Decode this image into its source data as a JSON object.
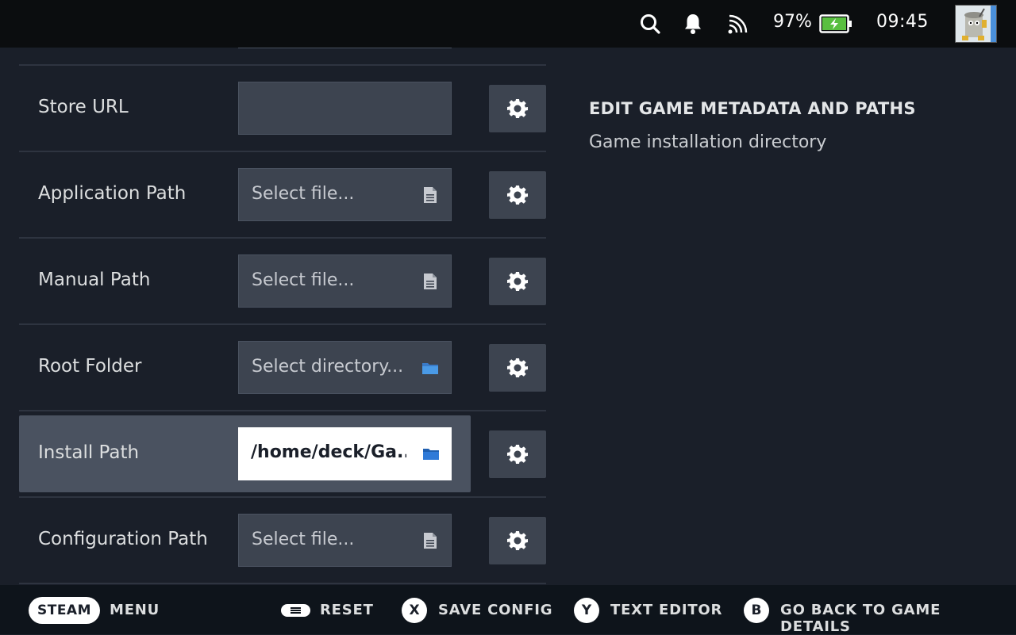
{
  "status_bar": {
    "battery_percent": "97%",
    "clock": "09:45",
    "icons": [
      "search-icon",
      "bell-icon",
      "wifi-icon",
      "battery-icon",
      "avatar"
    ]
  },
  "rows": [
    {
      "label": "Store URL",
      "value": "",
      "icon": "none"
    },
    {
      "label": "Application Path",
      "value": "Select file...",
      "icon": "file-icon"
    },
    {
      "label": "Manual Path",
      "value": "Select file...",
      "icon": "file-icon"
    },
    {
      "label": "Root Folder",
      "value": "Select directory...",
      "icon": "folder-icon"
    },
    {
      "label": "Install Path",
      "value": "/home/deck/Ga...",
      "icon": "folder-icon"
    },
    {
      "label": "Configuration Path",
      "value": "Select file...",
      "icon": "file-icon"
    }
  ],
  "panel": {
    "title": "EDIT GAME METADATA AND PATHS",
    "description": "Game installation directory"
  },
  "bottom_bar": {
    "steam": "STEAM",
    "menu": "MENU",
    "reset": "RESET",
    "x_button": "X",
    "save_config": "SAVE CONFIG",
    "y_button": "Y",
    "text_editor": "TEXT EDITOR",
    "b_button": "B",
    "go_back": "GO BACK TO GAME DETAILS"
  },
  "colors": {
    "background": "#1a1f29",
    "field": "#3d4450",
    "selected_row": "#4a5260",
    "folder_icon": "#4a9ae6",
    "file_icon": "#c7cad0"
  }
}
